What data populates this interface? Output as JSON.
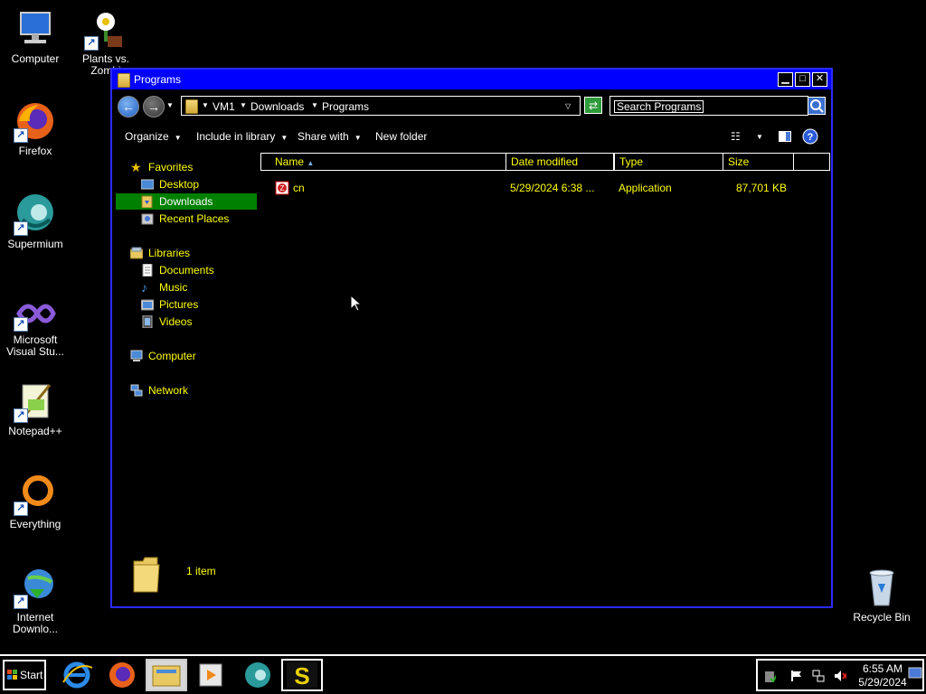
{
  "desktop": {
    "icons": [
      {
        "label": "Computer",
        "icon": "computer-icon"
      },
      {
        "label": "Plants vs. Zombi",
        "icon": "plants-vs-zombies-icon"
      },
      {
        "label": "Firefox",
        "icon": "firefox-icon"
      },
      {
        "label": "Supermium",
        "icon": "supermium-icon"
      },
      {
        "label": "Microsoft Visual Stu...",
        "icon": "visual-studio-icon"
      },
      {
        "label": "Notepad++",
        "icon": "notepad-plus-plus-icon"
      },
      {
        "label": "Everything",
        "icon": "everything-icon"
      },
      {
        "label": "Internet Downlo...",
        "icon": "internet-download-manager-icon"
      },
      {
        "label": "Recycle Bin",
        "icon": "recycle-bin-icon"
      }
    ]
  },
  "window": {
    "title": "Programs",
    "breadcrumb": [
      "VM1",
      "Downloads",
      "Programs"
    ],
    "search_placeholder": "Search Programs",
    "toolbar": {
      "organize": "Organize",
      "include_in_library": "Include in library",
      "share_with": "Share with",
      "new_folder": "New folder"
    },
    "nav": {
      "favorites": "Favorites",
      "desktop": "Desktop",
      "downloads": "Downloads",
      "recent_places": "Recent Places",
      "libraries": "Libraries",
      "documents": "Documents",
      "music": "Music",
      "pictures": "Pictures",
      "videos": "Videos",
      "computer": "Computer",
      "network": "Network"
    },
    "columns": {
      "name": "Name",
      "date_modified": "Date modified",
      "type": "Type",
      "size": "Size"
    },
    "files": [
      {
        "name": "cn",
        "date_modified": "5/29/2024 6:38 ...",
        "type": "Application",
        "size": "87,701 KB"
      }
    ],
    "status": "1 item"
  },
  "taskbar": {
    "start_label": "Start",
    "apps": [
      "internet-explorer-icon",
      "firefox-icon",
      "file-explorer-icon",
      "media-player-icon",
      "supermium-icon",
      "sublime-icon"
    ],
    "clock_time": "6:55 AM",
    "clock_date": "5/29/2024"
  },
  "colors": {
    "title_bar": "#0000ff",
    "text_highlight": "#ffff00",
    "selection": "#008000",
    "background": "#000000"
  }
}
